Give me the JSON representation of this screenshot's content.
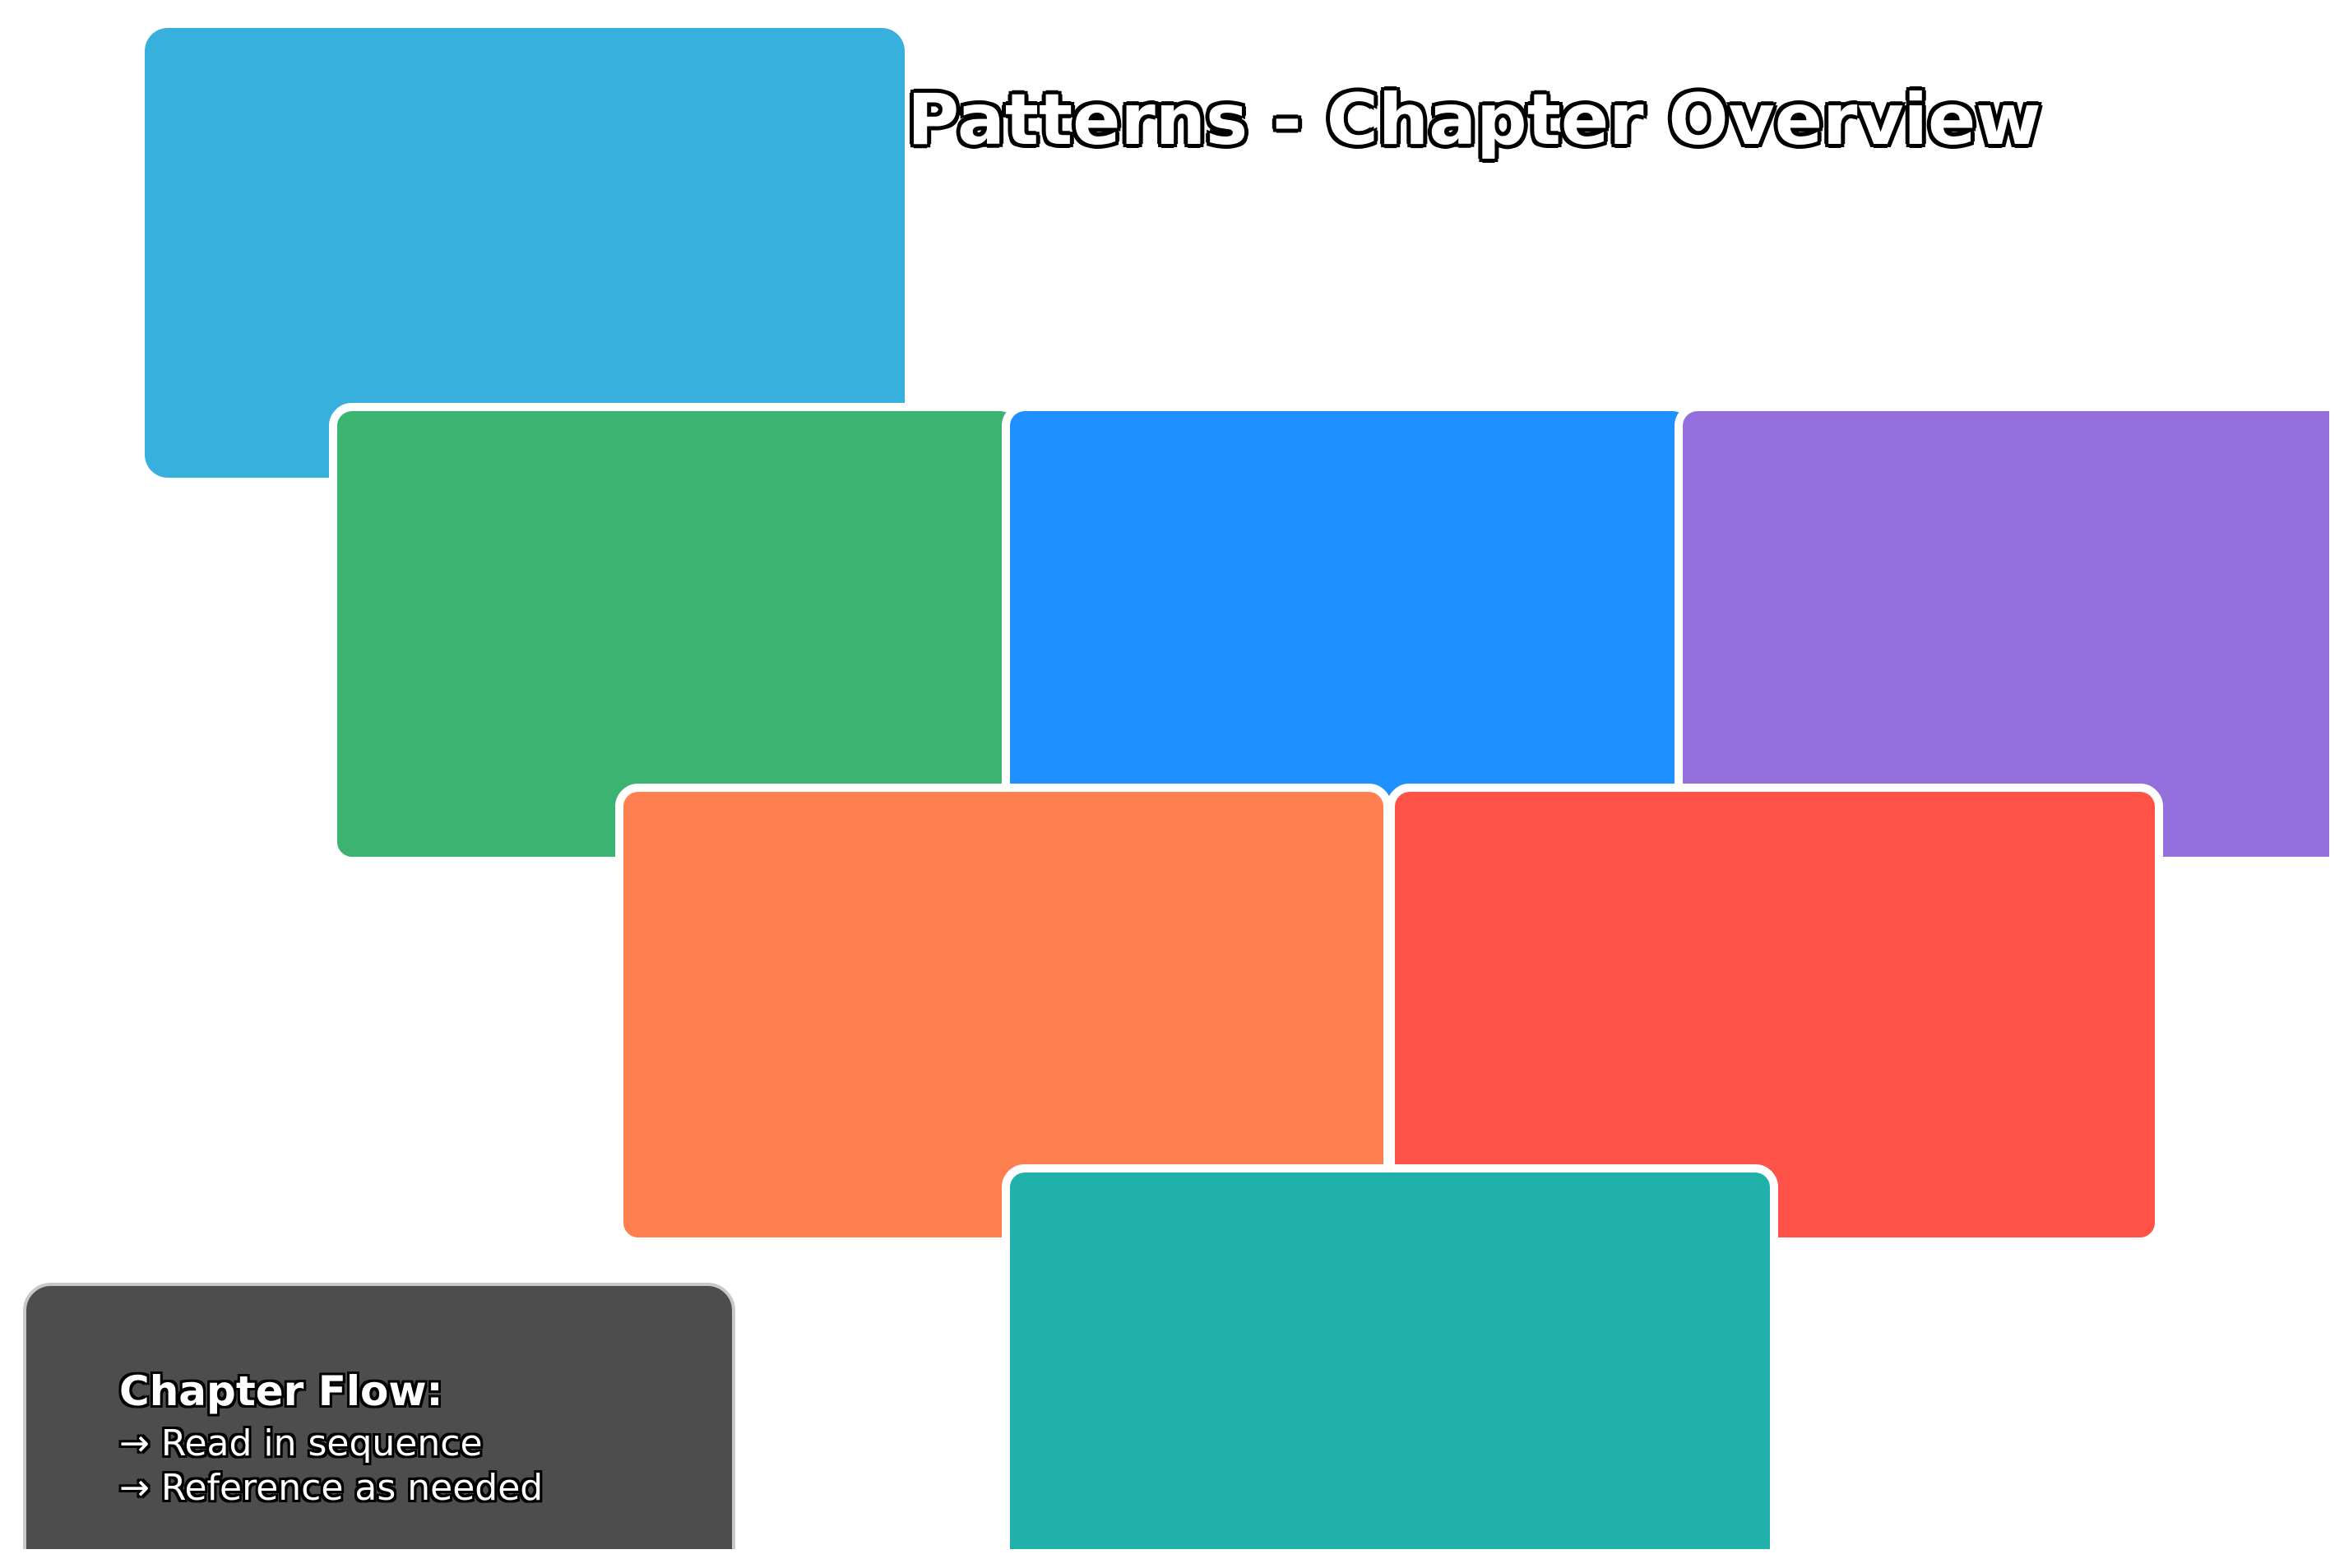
{
  "title": {
    "text": "Design Patterns - Chapter Overview"
  },
  "colors": {
    "card_1": "#38b0de",
    "card_2": "#3cb371",
    "card_3": "#1e90ff",
    "card_4": "#9370db",
    "card_5": "#ff7f50",
    "card_6": "#ff5349",
    "card_7": "#20b2aa",
    "flow_box": "#4d4d4d"
  },
  "chapter_flow": {
    "heading": "Chapter Flow:",
    "items": [
      "→ Read in sequence",
      "→ Reference as needed"
    ]
  }
}
